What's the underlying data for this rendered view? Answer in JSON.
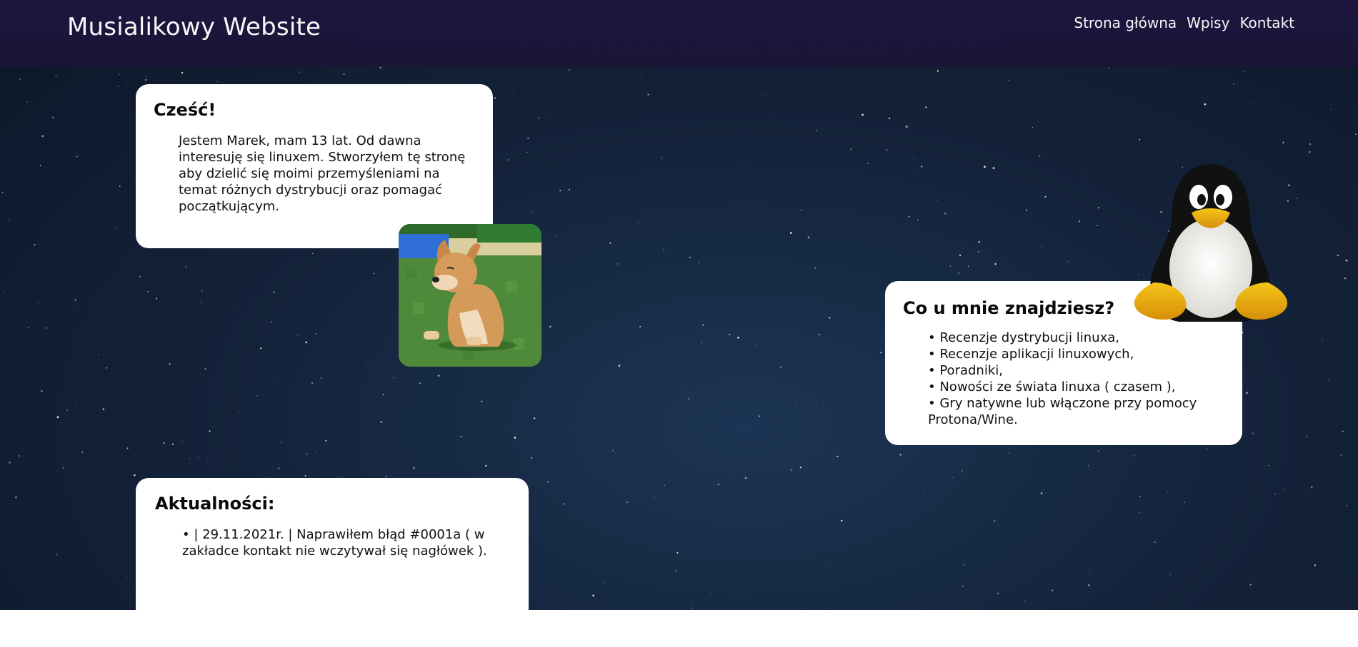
{
  "header": {
    "site_title": "Musialikowy Website",
    "nav": [
      {
        "label": "Strona główna"
      },
      {
        "label": "Wpisy"
      },
      {
        "label": "Kontakt"
      }
    ]
  },
  "intro": {
    "heading": "Cześć!",
    "text": "Jestem Marek, mam 13 lat. Od dawna interesuję się linuxem. Stworzyłem tę stronę aby dzielić się moimi przemyśleniami na temat różnych dystrybucji oraz pomagać początkującym."
  },
  "features": {
    "heading": "Co u mnie znajdziesz?",
    "items": [
      "Recenzje dystrybucji linuxa,",
      "Recenzje aplikacji linuxowych,",
      "Poradniki,",
      "Nowości ze świata linuxa ( czasem ),",
      "Gry natywne lub włączone przy pomocy Protona/Wine."
    ]
  },
  "news": {
    "heading": "Aktualności:",
    "items": [
      "| 29.11.2021r. | Naprawiłem błąd #0001a ( w zakładce kontakt nie wczytywał się nagłówek )."
    ]
  },
  "colors": {
    "header_bg": "#1e1540",
    "page_bg": "#14243c",
    "card_bg": "#ffffff"
  },
  "icons": [
    "doge-image",
    "tux-penguin-image"
  ]
}
